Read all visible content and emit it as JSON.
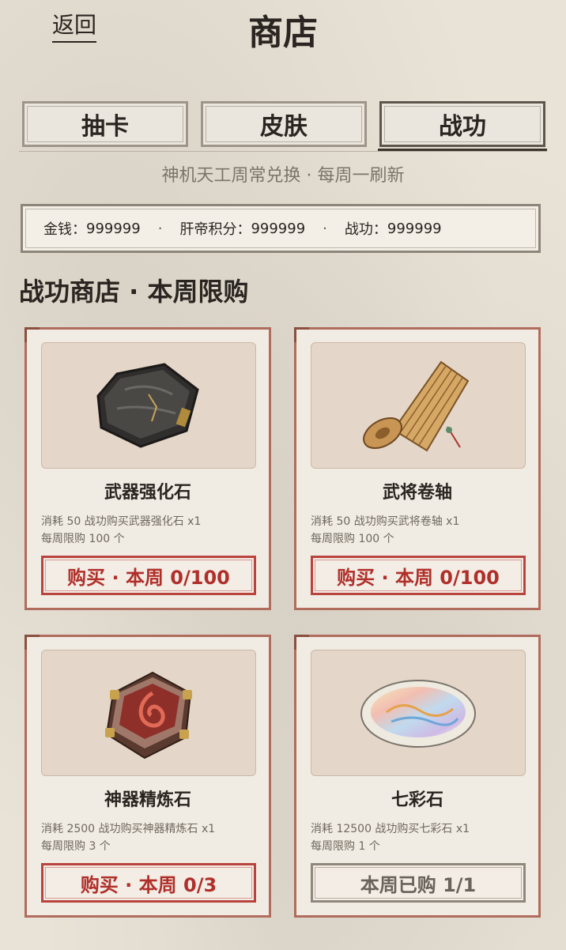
{
  "header": {
    "back_label": "返回",
    "title": "商店"
  },
  "tabs": [
    {
      "label": "抽卡",
      "active": false
    },
    {
      "label": "皮肤",
      "active": false
    },
    {
      "label": "战功",
      "active": true
    }
  ],
  "subtitle": "神机天工周常兑换 · 每周一刷新",
  "currency": {
    "gold_label": "金钱：",
    "gold": "999999",
    "points_label": "肝帝积分：",
    "points": "999999",
    "merit_label": "战功：",
    "merit": "999999",
    "separator": "·"
  },
  "section_title": "战功商店 · 本周限购",
  "items": [
    {
      "name": "武器强化石",
      "desc1": "消耗 50 战功购买武器强化石 x1",
      "desc2": "每周限购 100 个",
      "button": "购买 · 本周 0/100",
      "icon": "weapon-stone-icon",
      "sold_out": false
    },
    {
      "name": "武将卷轴",
      "desc1": "消耗 50 战功购买武将卷轴 x1",
      "desc2": "每周限购 100 个",
      "button": "购买 · 本周 0/100",
      "icon": "scroll-icon",
      "sold_out": false
    },
    {
      "name": "神器精炼石",
      "desc1": "消耗 2500 战功购买神器精炼石 x1",
      "desc2": "每周限购 3 个",
      "button": "购买 · 本周 0/3",
      "icon": "refine-stone-icon",
      "sold_out": false
    },
    {
      "name": "七彩石",
      "desc1": "消耗 12500 战功购买七彩石 x1",
      "desc2": "每周限购 1 个",
      "button": "本周已购 1/1",
      "icon": "rainbow-stone-icon",
      "sold_out": true
    }
  ],
  "colors": {
    "accent_red": "#b02f2a",
    "card_border": "#b06c5c",
    "background": "#e8e2d7"
  }
}
